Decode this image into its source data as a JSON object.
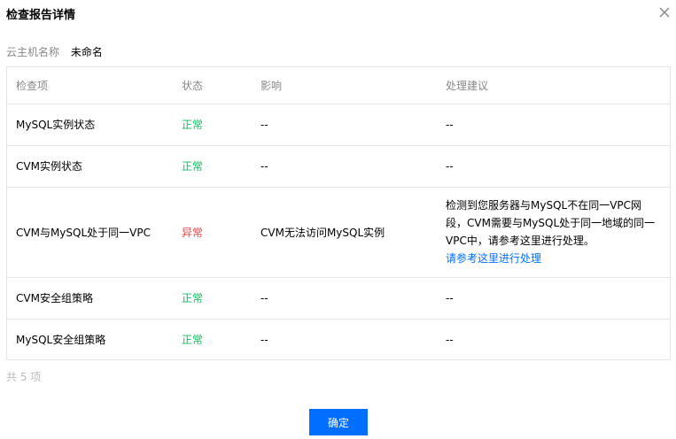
{
  "dialog": {
    "title": "检查报告详情",
    "close_icon": "close-icon"
  },
  "host": {
    "label": "云主机名称",
    "value": "未命名"
  },
  "table": {
    "headers": [
      "检查项",
      "状态",
      "影响",
      "处理建议"
    ],
    "rows": [
      {
        "item": "MySQL实例状态",
        "status": "正常",
        "impact": "--",
        "advice": "--"
      },
      {
        "item": "CVM实例状态",
        "status": "正常",
        "impact": "--",
        "advice": "--"
      },
      {
        "item": "CVM与MySQL处于同一VPC",
        "status": "异常",
        "impact": "CVM无法访问MySQL实例",
        "advice": "检测到您服务器与MySQL不在同一VPC网段，CVM需要与MySQL处于同一地域的同一VPC中，请参考这里进行处理。",
        "advice_link": "请参考这里进行处理"
      },
      {
        "item": "CVM安全组策略",
        "status": "正常",
        "impact": "--",
        "advice": "--"
      },
      {
        "item": "MySQL安全组策略",
        "status": "正常",
        "impact": "--",
        "advice": "--"
      }
    ]
  },
  "total": "共 5 项",
  "footer": {
    "confirm_label": "确定"
  },
  "colors": {
    "primary": "#006eff",
    "status_ok": "#0abf5b",
    "status_bad": "#e54545"
  }
}
